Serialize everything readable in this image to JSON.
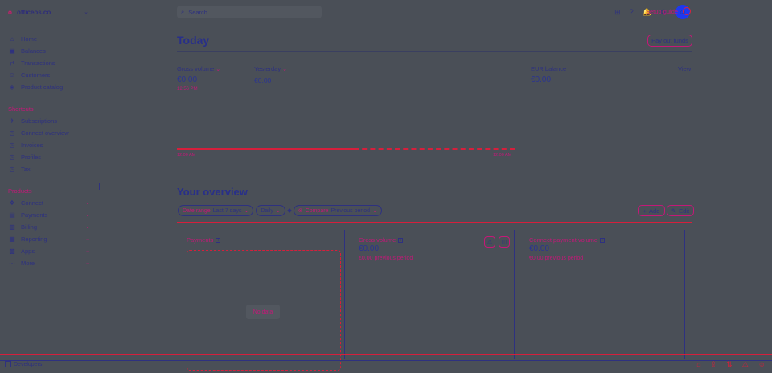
{
  "account": {
    "badge": "o",
    "name": "officeos.co"
  },
  "sidebar": {
    "main": [
      {
        "icon": "⌂",
        "label": "Home"
      },
      {
        "icon": "▣",
        "label": "Balances"
      },
      {
        "icon": "⇄",
        "label": "Transactions"
      },
      {
        "icon": "☺",
        "label": "Customers"
      },
      {
        "icon": "◈",
        "label": "Product catalog"
      }
    ],
    "shortcuts_title": "Shortcuts",
    "shortcuts": [
      {
        "icon": "✈",
        "label": "Subscriptions"
      },
      {
        "icon": "◷",
        "label": "Connect overview"
      },
      {
        "icon": "◷",
        "label": "Invoices"
      },
      {
        "icon": "◷",
        "label": "Profiles"
      },
      {
        "icon": "◷",
        "label": "Tax"
      }
    ],
    "products_title": "Products",
    "products": [
      {
        "icon": "❖",
        "label": "Connect"
      },
      {
        "icon": "▤",
        "label": "Payments"
      },
      {
        "icon": "▥",
        "label": "Billing"
      },
      {
        "icon": "▦",
        "label": "Reporting"
      },
      {
        "icon": "▩",
        "label": "Apps"
      },
      {
        "icon": "⋯",
        "label": "More"
      }
    ],
    "expand_glyph": "⌄"
  },
  "topbar": {
    "search_placeholder": "Search",
    "icons": [
      "⊞",
      "?",
      "🔔",
      "⚙"
    ],
    "avatar_glyph": "☺",
    "setup_guide": "Setup guide"
  },
  "today": {
    "title": "Today",
    "payout_button": "Pay out funds",
    "gross_label": "Gross volume",
    "gross_value": "€0.00",
    "gross_time": "12:56 PM",
    "yesterday_label": "Yesterday",
    "yesterday_value": "€0.00",
    "balance_label": "EUR balance",
    "balance_value": "€0.00",
    "view_link": "View",
    "chart_start": "12:00 AM",
    "chart_end": "12:00 AM"
  },
  "overview": {
    "title": "Your overview",
    "filters": {
      "date_range": "Date range",
      "date_value": "Last 7 days",
      "interval": "Daily",
      "compare": "Compare",
      "compare_value": "Previous period"
    },
    "add_button": "Add",
    "edit_button": "Edit",
    "cards": [
      {
        "title": "Payments",
        "no_data": "No data"
      },
      {
        "title": "Gross volume",
        "value": "€0.00",
        "sub": "€0.00 previous period"
      },
      {
        "title": "Connect payment volume",
        "value": "€0.00",
        "sub": "€0.00 previous period"
      }
    ]
  },
  "footer": {
    "developers": "Developers"
  }
}
